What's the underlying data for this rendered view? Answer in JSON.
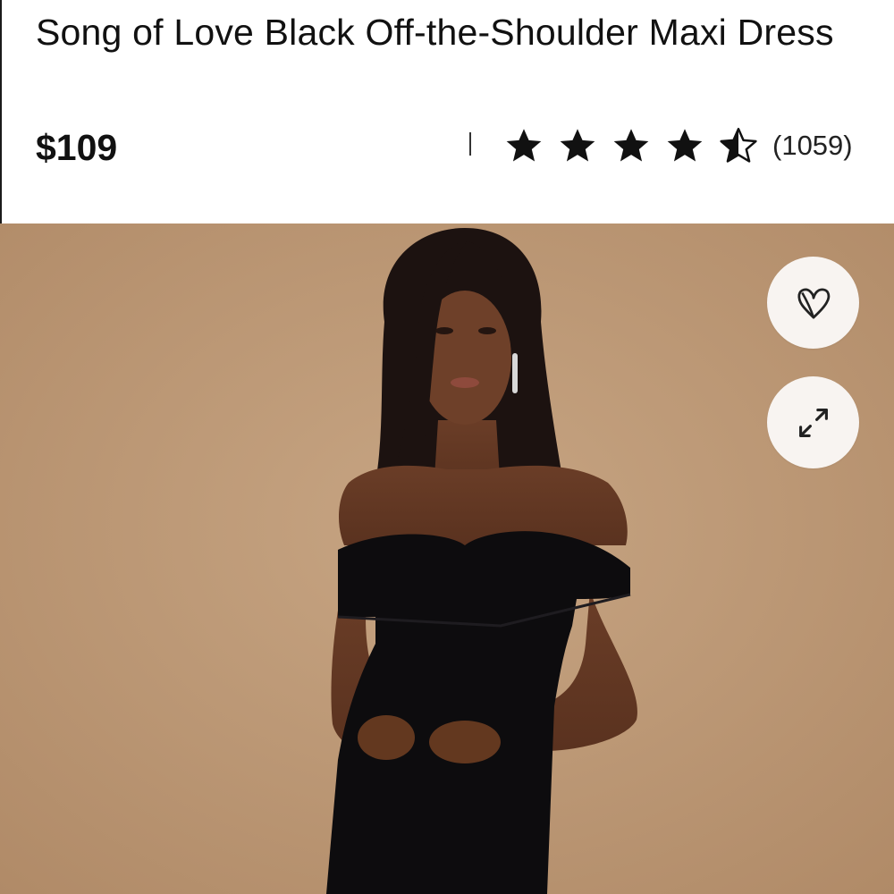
{
  "product": {
    "title": "Song of Love Black Off-the-Shoulder Maxi Dress",
    "price": "$109",
    "rating": 4.5,
    "rating_max": 5,
    "review_count": "(1059)"
  },
  "actions": {
    "favorite_icon": "heart-icon",
    "expand_icon": "expand-arrows-icon"
  },
  "colors": {
    "photo_background": "#c09a77",
    "button_background": "#f8f4f1",
    "text": "#111111"
  }
}
